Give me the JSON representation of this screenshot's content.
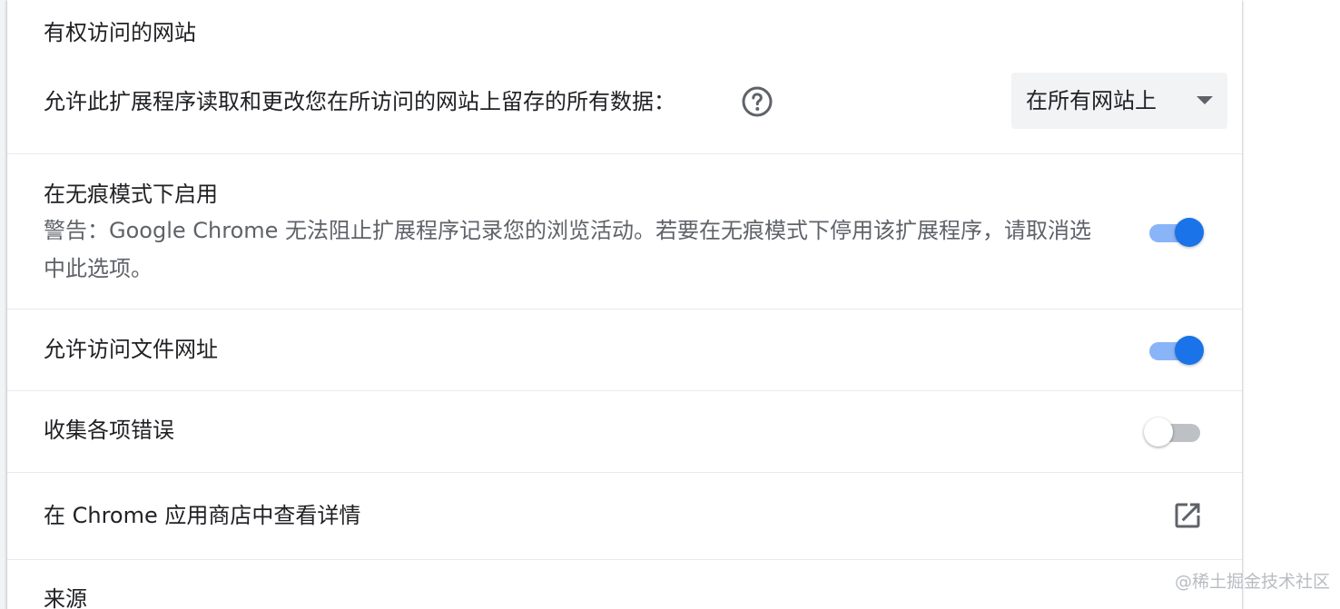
{
  "site_access": {
    "title": "有权访问的网站",
    "description": "允许此扩展程序读取和更改您在所访问的网站上留存的所有数据：",
    "help_icon": "help-circle-icon",
    "dropdown_value": "在所有网站上"
  },
  "incognito": {
    "title": "在无痕模式下启用",
    "warning": "警告：Google Chrome 无法阻止扩展程序记录您的浏览活动。若要在无痕模式下停用该扩展程序，请取消选中此选项。",
    "enabled": true
  },
  "file_urls": {
    "title": "允许访问文件网址",
    "enabled": true
  },
  "collect_errors": {
    "title": "收集各项错误",
    "enabled": false
  },
  "webstore": {
    "title": "在 Chrome 应用商店中查看详情",
    "icon": "open-in-new-icon"
  },
  "source": {
    "title": "来源"
  },
  "watermark": "@稀土掘金技术社区",
  "colors": {
    "accent": "#1a73e8",
    "accent_light": "#8ab4f8",
    "toggle_off_track": "#bdc1c6",
    "text_primary": "#202124",
    "text_secondary": "#5f6368",
    "divider": "#e8eaed"
  }
}
